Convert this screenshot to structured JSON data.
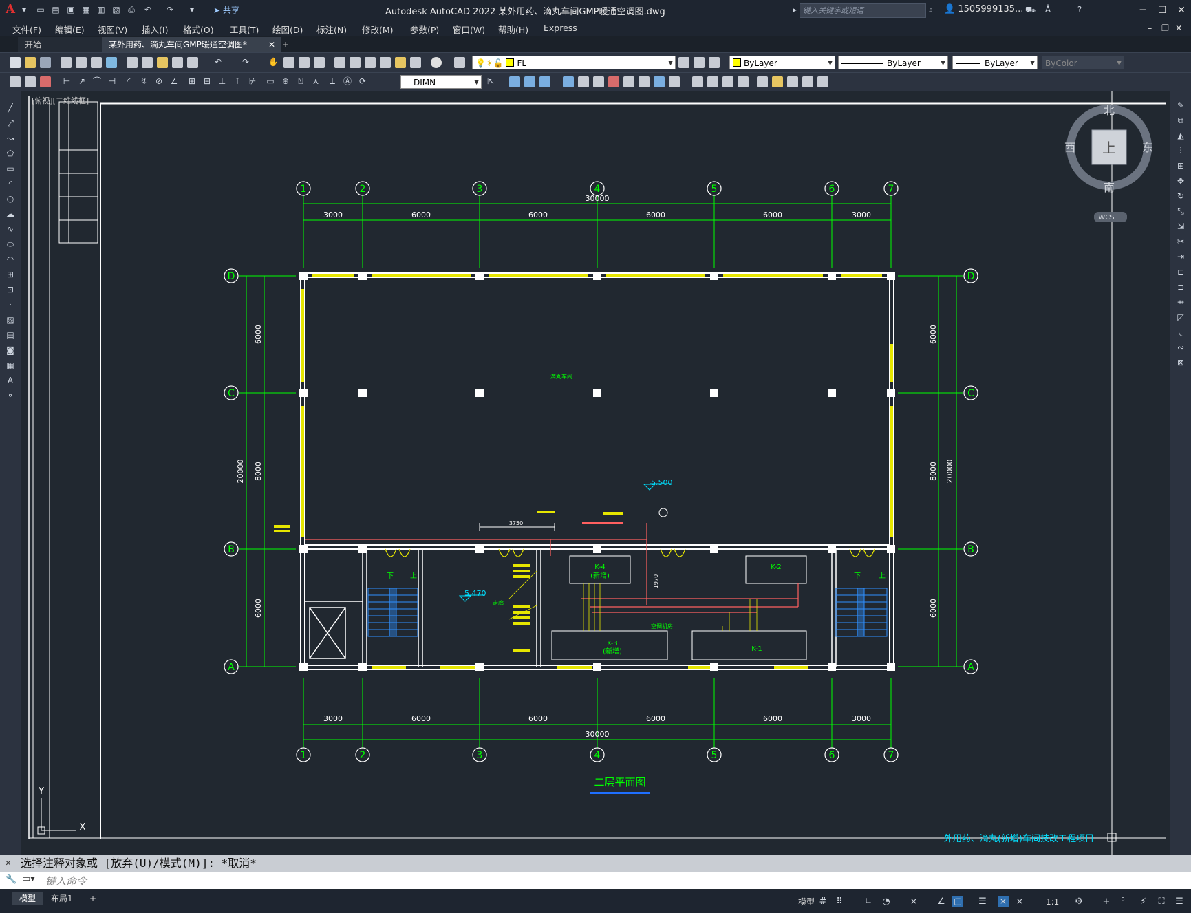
{
  "app": {
    "title": "Autodesk AutoCAD 2022    某外用药、滴丸车间GMP暖通空调图.dwg",
    "share_label": "共享",
    "search_placeholder": "键入关键字或短语",
    "user": "1505999135...",
    "help_label": "?"
  },
  "menu": [
    "文件(F)",
    "编辑(E)",
    "视图(V)",
    "插入(I)",
    "格式(O)",
    "工具(T)",
    "绘图(D)",
    "标注(N)",
    "修改(M)",
    "参数(P)",
    "窗口(W)",
    "帮助(H)",
    "Express"
  ],
  "tabs": {
    "start": "开始",
    "file": "某外用药、滴丸车间GMP暖通空调图*"
  },
  "toolbar": {
    "layer": "FL",
    "color": "ByLayer",
    "linetype": "ByLayer",
    "lineweight": "ByLayer",
    "plotstyle": "ByColor",
    "dimstyle": "DIMN"
  },
  "viewport_label": "[俯视][二维线框]",
  "viewcube": {
    "north": "北",
    "south": "南",
    "east": "东",
    "west": "西",
    "face": "上",
    "ucs": "WCS"
  },
  "plan": {
    "grid_cols": [
      "1",
      "2",
      "3",
      "4",
      "5",
      "6",
      "7"
    ],
    "grid_rows": [
      "D",
      "C",
      "B",
      "A"
    ],
    "col_dims": [
      "3000",
      "6000",
      "6000",
      "6000",
      "6000",
      "3000"
    ],
    "total_width": "30000",
    "row_dims_left": [
      "6000",
      "8000",
      "6000"
    ],
    "total_height": "20000",
    "elev1": "5.500",
    "elev2": "5.470",
    "dim_3750": "3750",
    "dim_1970": "1970",
    "room_top": "滴丸车间",
    "equip": [
      "K-4",
      "K-2",
      "K-3",
      "K-1"
    ],
    "equip_note": "(新增)",
    "stair_down": "下",
    "stair_up": "上",
    "room_label1": "空调机房",
    "room_label2": "走廊",
    "drawing_title": "二层平面图",
    "project_title": "外用药、滴丸(新增)车间技改工程项目"
  },
  "ucs": {
    "y": "Y",
    "x": "X"
  },
  "command": {
    "history": "选择注释对象或 [放弃(U)/模式(M)]: *取消*",
    "placeholder": "键入命令"
  },
  "status": {
    "model_tab": "模型",
    "layout_tab": "布局1",
    "model_btn": "模型",
    "scale": "1:1"
  }
}
